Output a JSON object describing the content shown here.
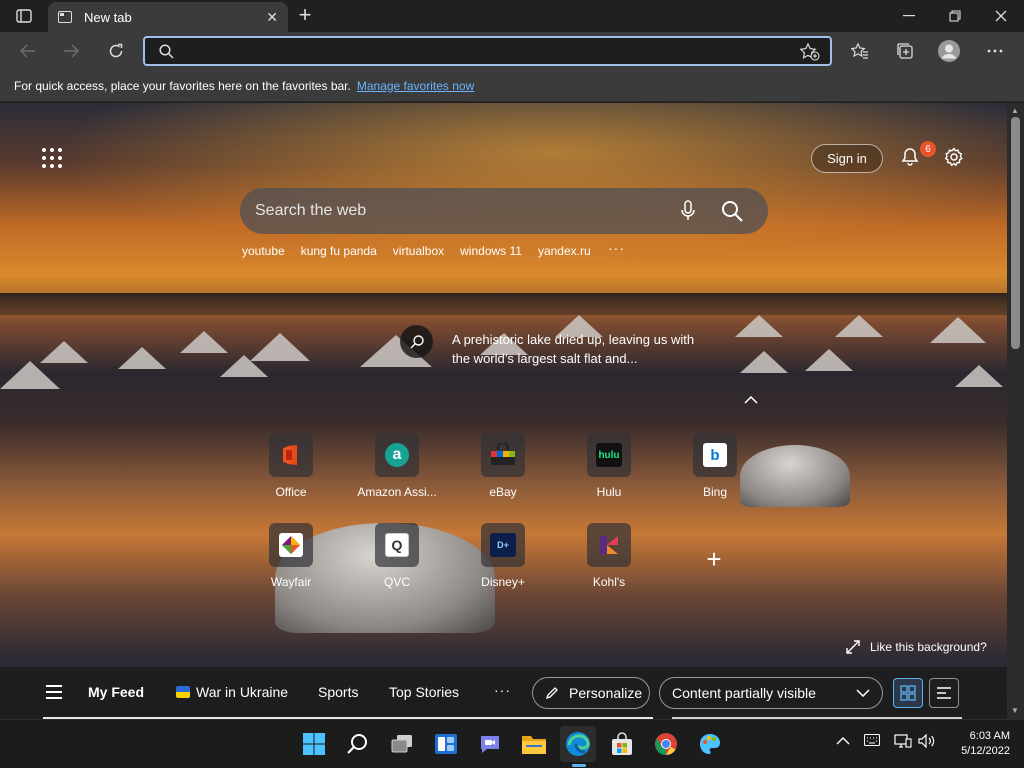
{
  "browser": {
    "tab_title": "New tab",
    "address_value": "",
    "favorites_bar": {
      "message": "For quick access, place your favorites here on the favorites bar.",
      "link": "Manage favorites now"
    }
  },
  "newtab": {
    "sign_in": "Sign in",
    "notification_count": "6",
    "search_placeholder": "Search the web",
    "trending": [
      "youtube",
      "kung fu panda",
      "virtualbox",
      "windows 11",
      "yandex.ru"
    ],
    "trending_more": "···",
    "background_caption": "A prehistoric lake dried up, leaving us with the world’s largest salt flat and...",
    "quick_links": [
      {
        "label": "Office",
        "icon": "office-icon"
      },
      {
        "label": "Amazon Assi...",
        "icon": "amazon-icon"
      },
      {
        "label": "eBay",
        "icon": "ebay-icon"
      },
      {
        "label": "Hulu",
        "icon": "hulu-icon"
      },
      {
        "label": "Bing",
        "icon": "bing-icon"
      },
      {
        "label": "Wayfair",
        "icon": "wayfair-icon"
      },
      {
        "label": "QVC",
        "icon": "qvc-icon"
      },
      {
        "label": "Disney+",
        "icon": "disney-icon"
      },
      {
        "label": "Kohl's",
        "icon": "kohls-icon"
      }
    ],
    "add_tile": "+",
    "like_background": "Like this background?",
    "feed": {
      "my_feed": "My Feed",
      "war_in_ukraine": "War in Ukraine",
      "sports": "Sports",
      "top_stories": "Top Stories",
      "more": "···",
      "personalize": "Personalize",
      "content_visibility": "Content partially visible"
    }
  },
  "taskbar": {
    "time": "6:03 AM",
    "date": "5/12/2022"
  },
  "colors": {
    "accent": "#5fb2f2",
    "link": "#6cb4ff",
    "badge": "#e8542a"
  }
}
